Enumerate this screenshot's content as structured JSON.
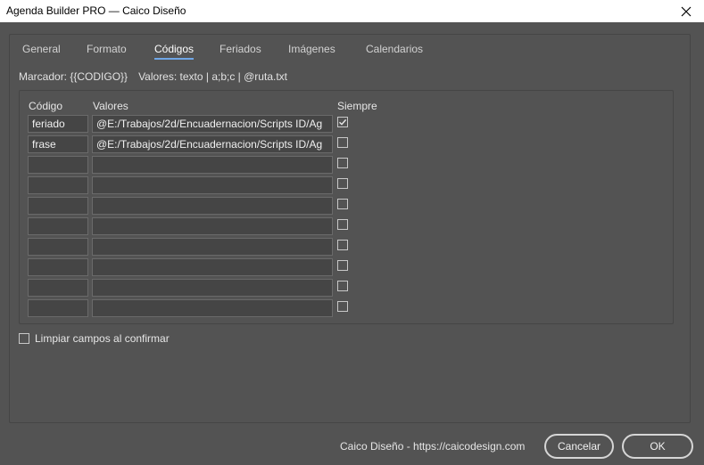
{
  "window": {
    "title": "Agenda Builder PRO — Caico Diseño",
    "close_icon": "close-icon"
  },
  "tabs": [
    {
      "label": "General",
      "active": false
    },
    {
      "label": "Formato",
      "active": false
    },
    {
      "label": "Códigos",
      "active": true
    },
    {
      "label": "Feriados",
      "active": false
    },
    {
      "label": "Imágenes",
      "active": false
    },
    {
      "label": "Calendarios",
      "active": false
    }
  ],
  "hint": {
    "marker": "Marcador: {{CODIGO}}",
    "values": "Valores: texto | a;b;c | @ruta.txt"
  },
  "table": {
    "headers": {
      "code": "Código",
      "values": "Valores",
      "always": "Siempre"
    },
    "rows": [
      {
        "code": "feriado",
        "value": "@E:/Trabajos/2d/Encuadernacion/Scripts ID/Ag",
        "always": true
      },
      {
        "code": "frase",
        "value": "@E:/Trabajos/2d/Encuadernacion/Scripts ID/Ag",
        "always": false
      },
      {
        "code": "",
        "value": "",
        "always": false
      },
      {
        "code": "",
        "value": "",
        "always": false
      },
      {
        "code": "",
        "value": "",
        "always": false
      },
      {
        "code": "",
        "value": "",
        "always": false
      },
      {
        "code": "",
        "value": "",
        "always": false
      },
      {
        "code": "",
        "value": "",
        "always": false
      },
      {
        "code": "",
        "value": "",
        "always": false
      },
      {
        "code": "",
        "value": "",
        "always": false
      }
    ]
  },
  "clear_fields": {
    "label": "Limpiar campos al confirmar",
    "checked": false
  },
  "footer": {
    "credit": "Caico Diseño - https://caicodesign.com",
    "cancel_label": "Cancelar",
    "ok_label": "OK"
  },
  "colors": {
    "background": "#535353",
    "active_tab_underline": "#6fa6e6",
    "titlebar": "#ffffff"
  }
}
